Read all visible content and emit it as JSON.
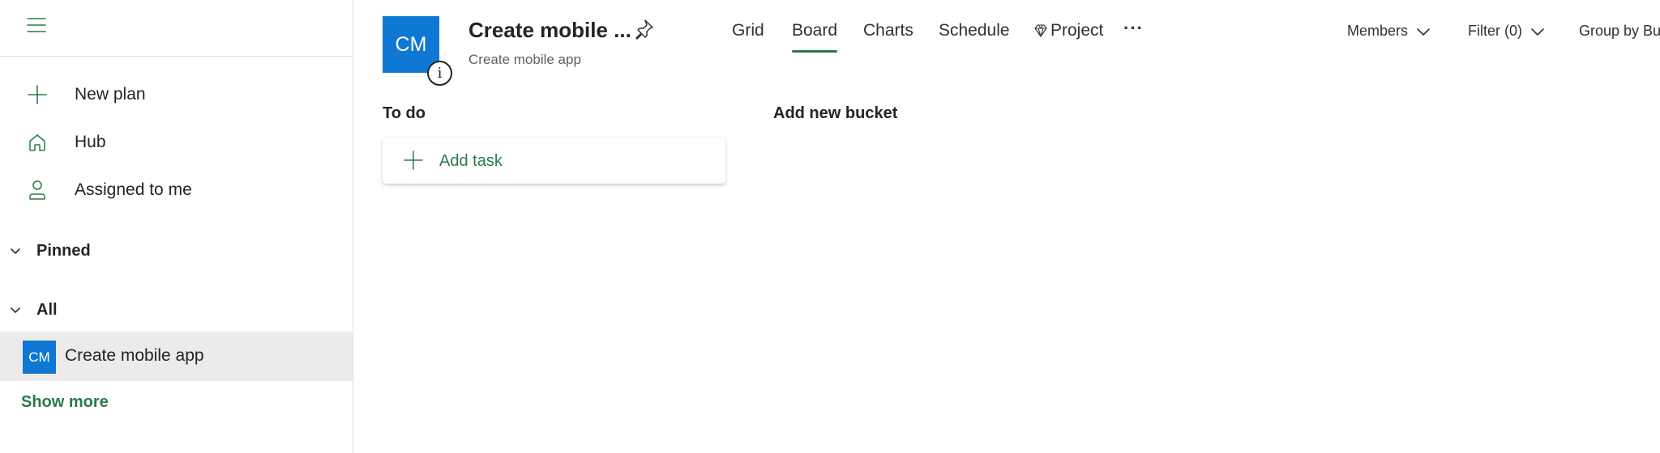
{
  "sidebar": {
    "items": [
      {
        "label": "New plan",
        "icon": "plus-icon"
      },
      {
        "label": "Hub",
        "icon": "home-icon"
      },
      {
        "label": "Assigned to me",
        "icon": "person-icon"
      }
    ],
    "sections": [
      {
        "label": "Pinned"
      },
      {
        "label": "All"
      }
    ],
    "plan": {
      "avatar": "CM",
      "label": "Create mobile app"
    },
    "show_more": "Show more"
  },
  "header": {
    "tile": "CM",
    "info": "i",
    "title": "Create mobile ...",
    "subtitle": "Create mobile app",
    "tabs": [
      {
        "label": "Grid"
      },
      {
        "label": "Board"
      },
      {
        "label": "Charts"
      },
      {
        "label": "Schedule"
      },
      {
        "label": "Project"
      }
    ],
    "more": "···",
    "members": "Members",
    "filter": "Filter (0)",
    "group_by": "Group by Bucket"
  },
  "board": {
    "buckets": [
      {
        "title": "To do"
      },
      {
        "title": "Add new bucket"
      }
    ],
    "add_task": "Add task"
  },
  "colors": {
    "accent": "#2b7a4b",
    "tile_blue": "#0f78d4",
    "selected_row": "#edebe9"
  }
}
